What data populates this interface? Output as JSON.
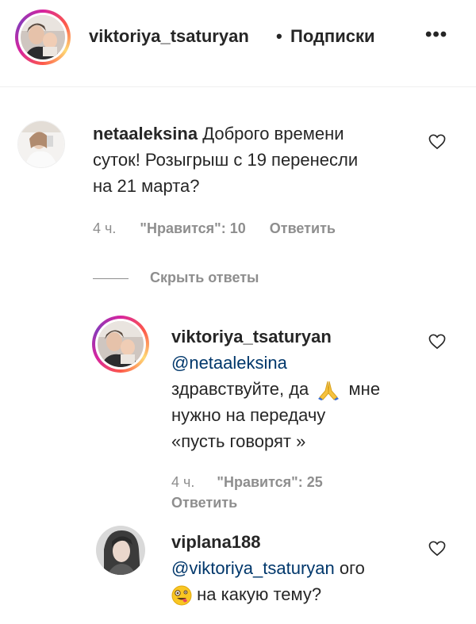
{
  "header": {
    "username": "viktoriya_tsaturyan",
    "separator": "•",
    "follow_status": "Подписки",
    "more_label": "•••"
  },
  "comments": [
    {
      "username": "netaaleksina",
      "text_line1": "Доброго времени",
      "text_line2": "суток! Розыгрыш с 19 перенесли",
      "text_line3": "на 21 марта?",
      "time": "4 ч.",
      "likes": "\"Нравится\": 10",
      "reply": "Ответить"
    }
  ],
  "hide_replies": "Скрыть ответы",
  "replies": [
    {
      "username": "viktoriya_tsaturyan",
      "mention": "@netaaleksina",
      "text_line1a": "здравствуйте, да",
      "emoji": "pray-emoji",
      "text_line1b": "мне",
      "text_line2": "нужно на передачу",
      "text_line3": "«пусть говорят »",
      "time": "4 ч.",
      "likes": "\"Нравится\": 25",
      "reply": "Ответить"
    },
    {
      "username": "viplana188",
      "mention": "@viktoriya_tsaturyan",
      "text_after_mention": "ого",
      "emoji": "zany-face-emoji",
      "text_line2": "на какую тему?"
    }
  ],
  "colors": {
    "text": "#262626",
    "muted": "#8e8e8e",
    "mention": "#00376b",
    "divider": "#efefef"
  }
}
